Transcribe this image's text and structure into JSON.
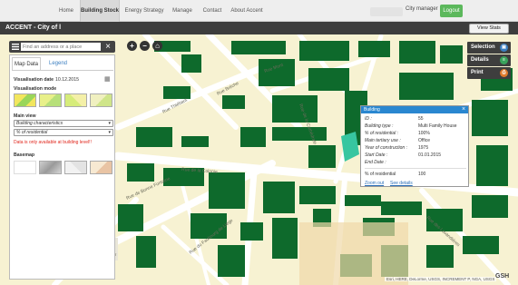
{
  "nav": {
    "items": [
      "Home",
      "Building Stock",
      "Energy Strategy",
      "Manage",
      "Contact",
      "About Accent"
    ],
    "active": "Building Stock",
    "user_role": "City manager",
    "logout": "Logout"
  },
  "titlebar": {
    "title": "ACCENT - City of l",
    "view_stats": "View Stats"
  },
  "search": {
    "placeholder": "Find an address or a place"
  },
  "panel": {
    "tabs": [
      "Map Data",
      "Legend"
    ],
    "visualisation_date_label": "Visualisation date",
    "visualisation_date": "10.12.2015",
    "visualisation_mode_label": "Visualisation mode",
    "main_view_label": "Main view",
    "main_view_value": "Building characteristics",
    "sub_view_value": "% of residential",
    "warning": "Data is only available at building level!!",
    "basemap_label": "Basemap"
  },
  "right_buttons": [
    {
      "label": "Selection",
      "icon": "selection-icon",
      "color": "#3a7ec0"
    },
    {
      "label": "Details",
      "icon": "details-icon",
      "color": "#3aa35c"
    },
    {
      "label": "Print",
      "icon": "print-icon",
      "color": "#e07a2b"
    }
  ],
  "popup": {
    "title": "Building",
    "rows": [
      {
        "label": "ID :",
        "value": "55"
      },
      {
        "label": "Building type :",
        "value": "Multi Family House"
      },
      {
        "label": "% of residential :",
        "value": "100%"
      },
      {
        "label": "Main tertiary use :",
        "value": "Office"
      },
      {
        "label": "Year of construction :",
        "value": "1975"
      },
      {
        "label": "Start Date :",
        "value": "01.01.2015"
      },
      {
        "label": "End Date :",
        "value": ""
      }
    ],
    "summary_label": "% of residential",
    "summary_value": "100",
    "zoom_link": "Zoom out",
    "see_details": "See details"
  },
  "map": {
    "streets": [
      "Rue Mont",
      "Rue Bréche",
      "Rue Thiébaut",
      "Rue de la Colonie",
      "Rue du Faubourg de Liège",
      "Rue de Bonne Fontaine",
      "Rue de la Cathédrale",
      "Rue des Lavandières"
    ],
    "place_label": "Pl. Robert Grenier",
    "colors": {
      "building": "#0e6a2c",
      "land": "#f7f2d2",
      "road": "#ffffff",
      "highlight": "#37c6a0"
    }
  },
  "attribution": "Esri, HERE, DeLorme, USGS, INCREMENT P, NGA, USGS",
  "logo_text": "GSH"
}
